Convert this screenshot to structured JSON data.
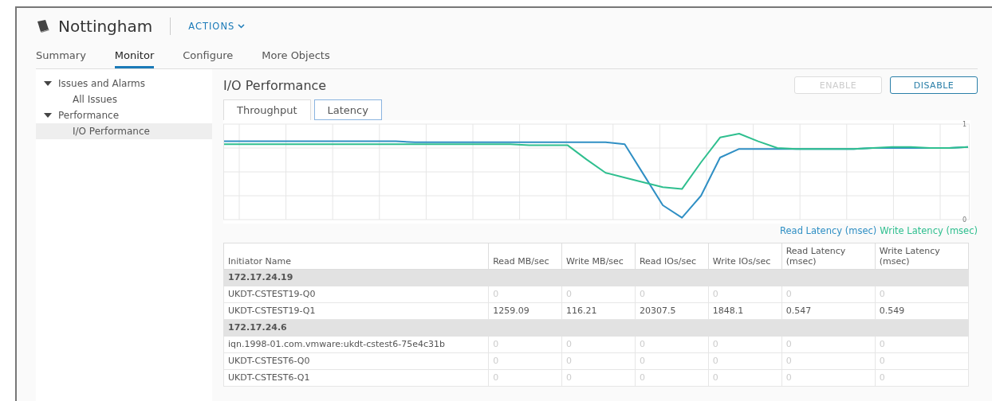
{
  "header": {
    "title": "Nottingham",
    "actions": "ACTIONS"
  },
  "tabs": [
    {
      "label": "Summary",
      "selected": false
    },
    {
      "label": "Monitor",
      "selected": true
    },
    {
      "label": "Configure",
      "selected": false
    },
    {
      "label": "More Objects",
      "selected": false
    }
  ],
  "sidebar": {
    "items": [
      {
        "label": "Issues and Alarms",
        "expanded": true,
        "selected": false,
        "children": [
          {
            "label": "All Issues",
            "selected": false
          }
        ]
      },
      {
        "label": "Performance",
        "expanded": true,
        "selected": false,
        "children": [
          {
            "label": "I/O Performance",
            "selected": true
          }
        ]
      }
    ]
  },
  "panel": {
    "title": "I/O Performance",
    "buttons": [
      {
        "label": "ENABLE",
        "disabled": true
      },
      {
        "label": "DISABLE",
        "disabled": false
      }
    ],
    "chart_tabs": [
      {
        "label": "Throughput",
        "selected": false
      },
      {
        "label": "Latency",
        "selected": true
      }
    ],
    "chart_data": {
      "type": "line",
      "grid": true,
      "ylim": [
        0,
        1
      ],
      "yticks": [
        0,
        1
      ],
      "series": [
        {
          "name": "Read Latency (msec)",
          "color": "#2f8fc4",
          "values": [
            0.82,
            0.82,
            0.82,
            0.82,
            0.82,
            0.82,
            0.82,
            0.82,
            0.82,
            0.82,
            0.81,
            0.81,
            0.81,
            0.81,
            0.81,
            0.81,
            0.81,
            0.81,
            0.81,
            0.81,
            0.81,
            0.79,
            0.47,
            0.15,
            0.02,
            0.25,
            0.65,
            0.74,
            0.74,
            0.74,
            0.74,
            0.74,
            0.74,
            0.74,
            0.75,
            0.75,
            0.75,
            0.75,
            0.75,
            0.76
          ]
        },
        {
          "name": "Write Latency (msec)",
          "color": "#2fbf8f",
          "values": [
            0.79,
            0.79,
            0.79,
            0.79,
            0.79,
            0.79,
            0.79,
            0.79,
            0.79,
            0.79,
            0.79,
            0.79,
            0.79,
            0.79,
            0.79,
            0.79,
            0.78,
            0.78,
            0.78,
            0.63,
            0.49,
            0.44,
            0.39,
            0.34,
            0.32,
            0.6,
            0.86,
            0.9,
            0.82,
            0.75,
            0.74,
            0.74,
            0.74,
            0.74,
            0.75,
            0.76,
            0.76,
            0.75,
            0.75,
            0.76
          ]
        }
      ]
    },
    "table": {
      "columns": [
        "Initiator Name",
        "Read MB/sec",
        "Write MB/sec",
        "Read IOs/sec",
        "Write IOs/sec",
        "Read Latency (msec)",
        "Write Latency (msec)"
      ],
      "groups": [
        {
          "name": "172.17.24.19",
          "rows": [
            [
              "UKDT-CSTEST19-Q0",
              "0",
              "0",
              "0",
              "0",
              "0",
              "0"
            ],
            [
              "UKDT-CSTEST19-Q1",
              "1259.09",
              "116.21",
              "20307.5",
              "1848.1",
              "0.547",
              "0.549"
            ]
          ]
        },
        {
          "name": "172.17.24.6",
          "rows": [
            [
              "iqn.1998-01.com.vmware:ukdt-cstest6-75e4c31b",
              "0",
              "0",
              "0",
              "0",
              "0",
              "0"
            ],
            [
              "UKDT-CSTEST6-Q0",
              "0",
              "0",
              "0",
              "0",
              "0",
              "0"
            ],
            [
              "UKDT-CSTEST6-Q1",
              "0",
              "0",
              "0",
              "0",
              "0",
              "0"
            ]
          ]
        }
      ]
    }
  }
}
